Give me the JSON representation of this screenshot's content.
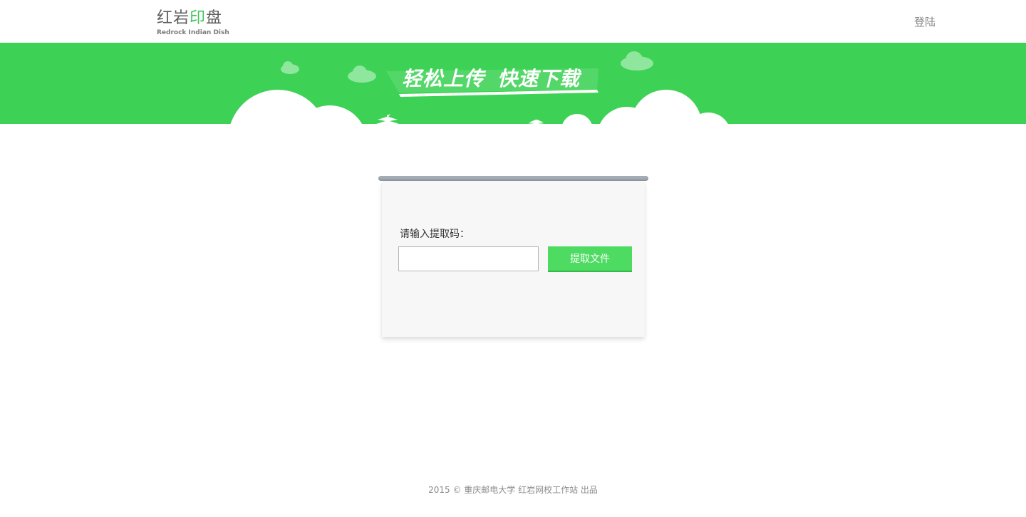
{
  "header": {
    "logo_cn_part1": "红岩",
    "logo_cn_accent": "印",
    "logo_cn_part2": "盘",
    "logo_en": "Redrock Indian Dish",
    "login_label": "登陆"
  },
  "banner": {
    "slogan_part1": "轻松上传",
    "slogan_part2": "快速下载"
  },
  "extract": {
    "label": "请输入提取码：",
    "input_value": "",
    "input_placeholder": "",
    "button_label": "提取文件"
  },
  "footer": {
    "text": "2015 © 重庆邮电大学 红岩网校工作站 出品"
  },
  "colors": {
    "brand_green": "#3dd255",
    "button_green": "#4ddb62",
    "text_gray": "#888888"
  }
}
